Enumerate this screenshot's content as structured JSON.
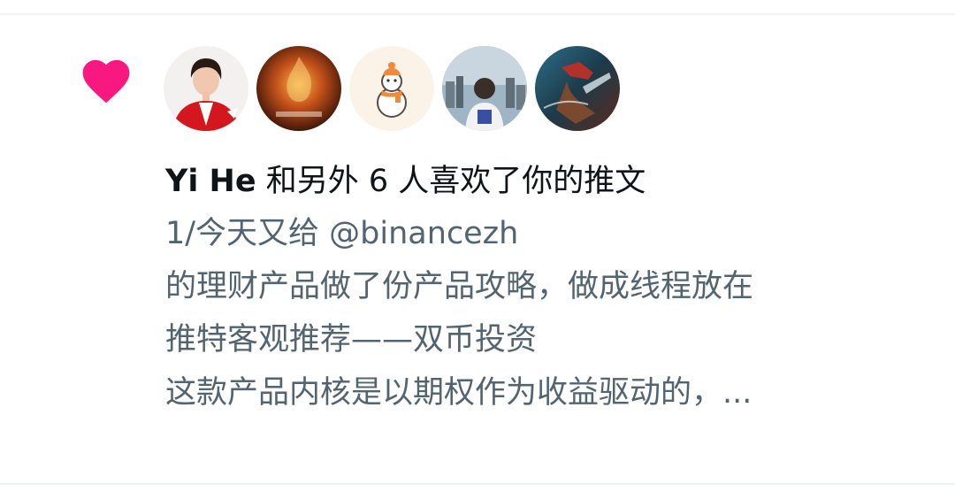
{
  "notification": {
    "icon": "heart-icon",
    "heart_color": "#f91880",
    "avatars": [
      {
        "name": "avatar-yi-he",
        "icon": "person-red-jacket-avatar"
      },
      {
        "name": "avatar-flame",
        "icon": "flame-artwork-avatar"
      },
      {
        "name": "avatar-snowman",
        "icon": "snowman-icon"
      },
      {
        "name": "avatar-city",
        "icon": "person-city-avatar"
      },
      {
        "name": "avatar-game",
        "icon": "game-character-avatar"
      }
    ],
    "liker_name": "Yi He",
    "summary_text": " 和另外 6 人喜欢了你的推文"
  },
  "tweet": {
    "lines": [
      "1/今天又给 @binancezh",
      "的理财产品做了份产品攻略，做成线程放在",
      "推特客观推荐——双币投资",
      "这款产品内核是以期权作为收益驱动的，..."
    ],
    "text_color": "#536471"
  }
}
